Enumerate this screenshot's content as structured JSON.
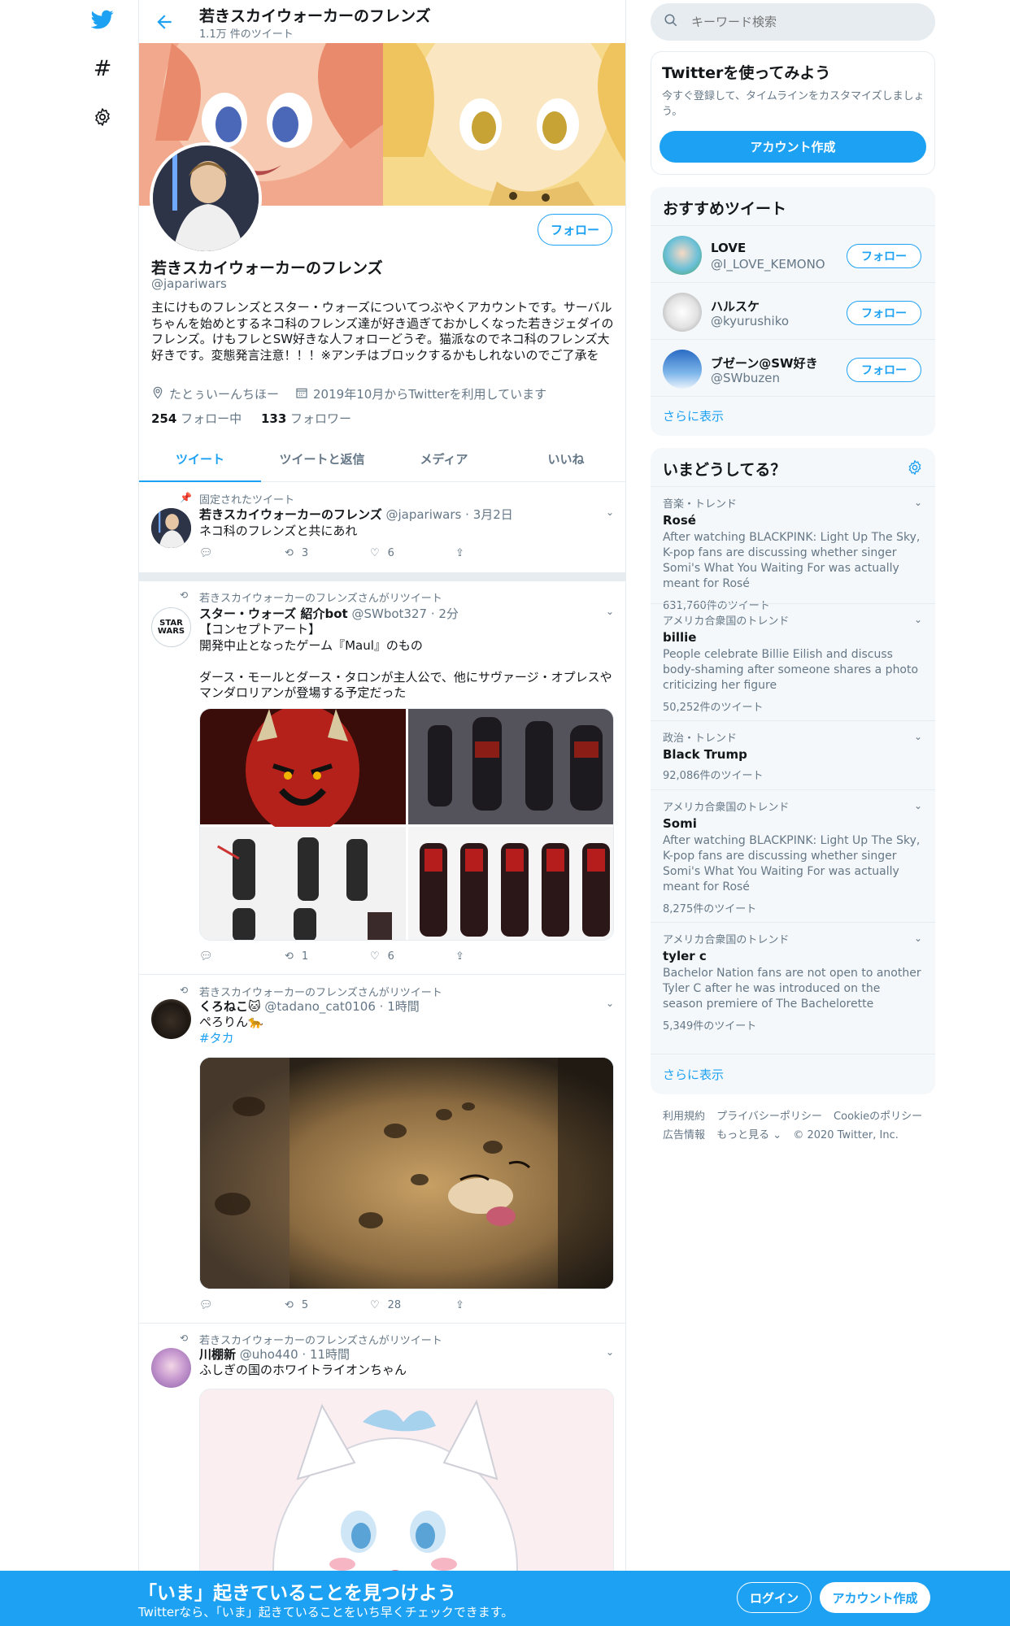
{
  "nav": {
    "icons": [
      "twitter-bird-icon",
      "hashtag-icon",
      "gear-icon"
    ]
  },
  "header": {
    "title": "若きスカイウォーカーのフレンズ",
    "tweet_count": "1.1万 件のツイート"
  },
  "profile": {
    "follow_label": "フォロー",
    "name": "若きスカイウォーカーのフレンズ",
    "handle": "@japariwars",
    "bio": "主にけものフレンズとスター・ウォーズについてつぶやくアカウントです。サーバルちゃんを始めとするネコ科のフレンズ達が好き過ぎておかしくなった若きジェダイのフレンズ。けもフレとSW好きな人フォローどうぞ。猫派なのでネコ科のフレンズ大好きです。変態発言注意！！！※アンチはブロックするかもしれないのでご了承を",
    "location": "たとぅいーんちほー",
    "joined": "2019年10月からTwitterを利用しています",
    "following_count": "254",
    "following_label": "フォロー中",
    "followers_count": "133",
    "followers_label": "フォロワー"
  },
  "tabs": [
    "ツイート",
    "ツイートと返信",
    "メディア",
    "いいね"
  ],
  "tweets": [
    {
      "context": "固定されたツイート",
      "name": "若きスカイウォーカーのフレンズ",
      "handle": "@japariwars",
      "time": "3月2日",
      "text": "ネコ科のフレンズと共にあれ",
      "replies": "",
      "retweets": "3",
      "likes": "6"
    },
    {
      "context": "若きスカイウォーカーのフレンズさんがリツイート",
      "name": "スター・ウォーズ 紹介bot",
      "handle": "@SWbot327",
      "time": "2分",
      "text": "【コンセプトアート】\n開発中止となったゲーム『Maul』のもの\n\nダース・モールとダース・タロンが主人公で、他にサヴァージ・オプレスやマンダロリアンが登場する予定だった",
      "replies": "",
      "retweets": "1",
      "likes": "6"
    },
    {
      "context": "若きスカイウォーカーのフレンズさんがリツイート",
      "name": "くろねこ🐱",
      "handle": "@tadano_cat0106",
      "time": "1時間",
      "text": "ぺろりん🐆",
      "hashtag": "#タカ",
      "replies": "",
      "retweets": "5",
      "likes": "28"
    },
    {
      "context": "若きスカイウォーカーのフレンズさんがリツイート",
      "name": "川棚新",
      "handle": "@uho440",
      "time": "11時間",
      "text": "ふしぎの国のホワイトライオンちゃん"
    }
  ],
  "sidebar": {
    "search_placeholder": "キーワード検索",
    "signup_box": {
      "title": "Twitterを使ってみよう",
      "text": "今すぐ登録して、タイムラインをカスタマイズしましょう。",
      "button": "アカウント作成"
    },
    "recommend": {
      "title": "おすすめツイート",
      "users": [
        {
          "name": "LOVE",
          "handle": "@I_LOVE_KEMONO",
          "button": "フォロー"
        },
        {
          "name": "ハルスケ",
          "handle": "@kyurushiko",
          "button": "フォロー"
        },
        {
          "name": "ブゼーン@SW好き",
          "handle": "@SWbuzen",
          "button": "フォロー"
        }
      ],
      "more": "さらに表示"
    },
    "trends": {
      "title": "いまどうしてる？",
      "items": [
        {
          "meta": "音楽・トレンド",
          "name": "Rosé",
          "desc": "After watching BLACKPINK: Light Up The Sky, K-pop fans are discussing whether singer Somi's What You Waiting For was actually meant for Rosé",
          "count": "631,760件のツイート"
        },
        {
          "meta": "アメリカ合衆国のトレンド",
          "name": "billie",
          "desc": "People celebrate Billie Eilish and discuss body-shaming after someone shares a photo criticizing her figure",
          "count": "50,252件のツイート"
        },
        {
          "meta": "政治・トレンド",
          "name": "Black Trump",
          "desc": "",
          "count": "92,086件のツイート"
        },
        {
          "meta": "アメリカ合衆国のトレンド",
          "name": "Somi",
          "desc": "After watching BLACKPINK: Light Up The Sky, K-pop fans are discussing whether singer Somi's What You Waiting For was actually meant for Rosé",
          "count": "8,275件のツイート"
        },
        {
          "meta": "アメリカ合衆国のトレンド",
          "name": "tyler c",
          "desc": "Bachelor Nation fans are not open to another Tyler C after he was introduced on the season premiere of The Bachelorette",
          "count": "5,349件のツイート"
        }
      ],
      "more": "さらに表示"
    },
    "footer": {
      "links": [
        "利用規約",
        "プライバシーポリシー",
        "Cookieのポリシー",
        "広告情報",
        "もっと見る ⌄"
      ],
      "copyright": "© 2020 Twitter, Inc."
    }
  },
  "bottom": {
    "title": "「いま」起きていることを見つけよう",
    "subtitle": "Twitterなら、「いま」起きていることをいち早くチェックできます。",
    "login": "ログイン",
    "signup": "アカウント作成"
  },
  "colors": {
    "accent": "#1da1f2",
    "text": "#14171a",
    "muted": "#657786",
    "border": "#e6ecf0"
  }
}
